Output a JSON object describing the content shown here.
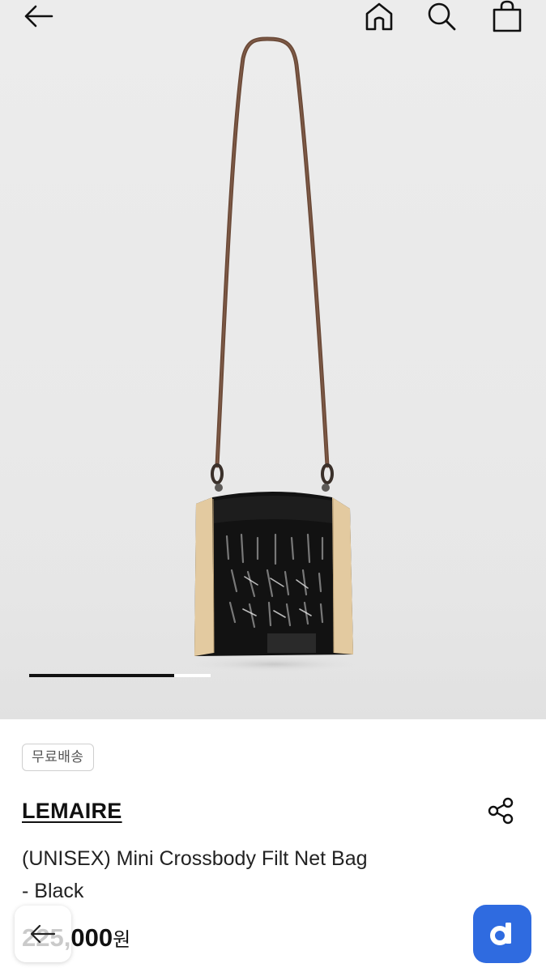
{
  "header": {
    "back_icon": "arrow-left-icon",
    "home_icon": "home-icon",
    "search_icon": "search-icon",
    "cart_icon": "shopping-bag-icon"
  },
  "gallery": {
    "image_subject": "black net crossbody bag with leather strap",
    "carousel_progress": 0.8
  },
  "product": {
    "badge": "무료배송",
    "brand": "LEMAIRE",
    "name_line1": "(UNISEX) Mini Crossbody Filt Net Bag",
    "name_line2": "- Black",
    "price_value": "225,000",
    "price_unit": "원",
    "share_icon": "share-icon"
  },
  "floating": {
    "back_icon": "arrow-left-icon",
    "app_icon": "app-d-icon"
  },
  "colors": {
    "accent": "#2f6be0",
    "text": "#111111",
    "background": "#ececec"
  }
}
